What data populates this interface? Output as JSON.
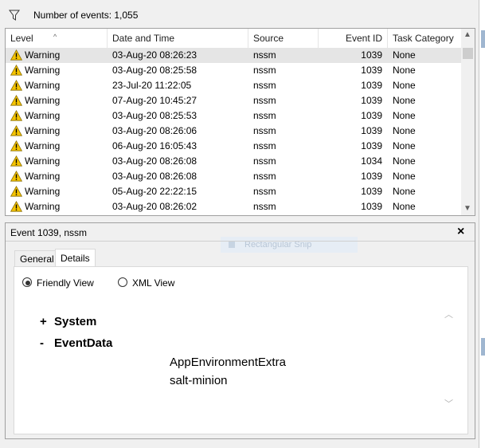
{
  "toolbar": {
    "filter_icon": "filter-funnel-icon",
    "events_count": "Number of events: 1,055"
  },
  "grid": {
    "columns": [
      "Level",
      "Date and Time",
      "Source",
      "Event ID",
      "Task Category"
    ],
    "sorted_column": "Level",
    "rows": [
      {
        "level": "Warning",
        "datetime": "03-Aug-20 08:26:23",
        "source": "nssm",
        "event_id": "1039",
        "task": "None"
      },
      {
        "level": "Warning",
        "datetime": "03-Aug-20 08:25:58",
        "source": "nssm",
        "event_id": "1039",
        "task": "None"
      },
      {
        "level": "Warning",
        "datetime": "23-Jul-20 11:22:05",
        "source": "nssm",
        "event_id": "1039",
        "task": "None"
      },
      {
        "level": "Warning",
        "datetime": "07-Aug-20 10:45:27",
        "source": "nssm",
        "event_id": "1039",
        "task": "None"
      },
      {
        "level": "Warning",
        "datetime": "03-Aug-20 08:25:53",
        "source": "nssm",
        "event_id": "1039",
        "task": "None"
      },
      {
        "level": "Warning",
        "datetime": "03-Aug-20 08:26:06",
        "source": "nssm",
        "event_id": "1039",
        "task": "None"
      },
      {
        "level": "Warning",
        "datetime": "06-Aug-20 16:05:43",
        "source": "nssm",
        "event_id": "1039",
        "task": "None"
      },
      {
        "level": "Warning",
        "datetime": "03-Aug-20 08:26:08",
        "source": "nssm",
        "event_id": "1034",
        "task": "None"
      },
      {
        "level": "Warning",
        "datetime": "03-Aug-20 08:26:08",
        "source": "nssm",
        "event_id": "1039",
        "task": "None"
      },
      {
        "level": "Warning",
        "datetime": "05-Aug-20 22:22:15",
        "source": "nssm",
        "event_id": "1039",
        "task": "None"
      },
      {
        "level": "Warning",
        "datetime": "03-Aug-20 08:26:02",
        "source": "nssm",
        "event_id": "1039",
        "task": "None"
      }
    ]
  },
  "details": {
    "title": "Event 1039, nssm",
    "close_label": "×",
    "overlay_hint": "Rectangular Snip",
    "tabs": [
      {
        "label": "General",
        "active": false
      },
      {
        "label": "Details",
        "active": true
      }
    ],
    "views": {
      "friendly_label": "Friendly View",
      "xml_label": "XML View",
      "selected": "friendly"
    },
    "tree": {
      "system": {
        "sign": "+",
        "label": "System"
      },
      "eventdata": {
        "sign": "-",
        "label": "EventData"
      },
      "values": [
        "AppEnvironmentExtra",
        "salt-minion"
      ]
    }
  },
  "colors": {
    "warning_yellow": "#f5c400",
    "selected_row": "#e5e5e5",
    "panel_bg": "#f0f0f0"
  }
}
